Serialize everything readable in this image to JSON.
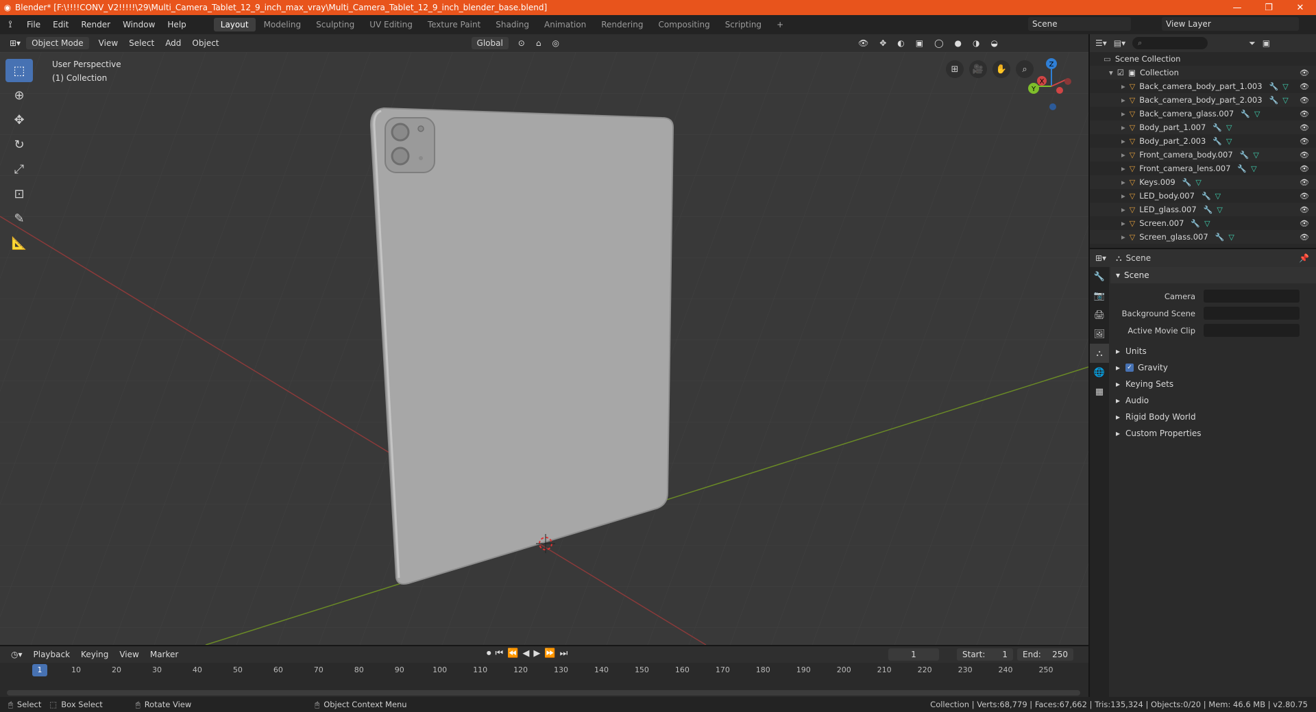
{
  "window": {
    "title": "Blender* [F:\\!!!!CONV_V2!!!!!\\29\\Multi_Camera_Tablet_12_9_inch_max_vray\\Multi_Camera_Tablet_12_9_inch_blender_base.blend]",
    "minimize": "—",
    "maximize": "❐",
    "close": "✕"
  },
  "menu": [
    "File",
    "Edit",
    "Render",
    "Window",
    "Help"
  ],
  "workspaces": [
    "Layout",
    "Modeling",
    "Sculpting",
    "UV Editing",
    "Texture Paint",
    "Shading",
    "Animation",
    "Rendering",
    "Compositing",
    "Scripting",
    "+"
  ],
  "scene_name": "Scene",
  "view_layer": "View Layer",
  "viewport_header": {
    "mode": "Object Mode",
    "menus": [
      "View",
      "Select",
      "Add",
      "Object"
    ],
    "transform": "Global"
  },
  "viewport": {
    "perspective": "User Perspective",
    "collection": "(1) Collection",
    "gizmo": {
      "z": "Z",
      "y": "Y",
      "x": "X"
    }
  },
  "outliner": {
    "search_placeholder": "⌕",
    "root": "Scene Collection",
    "collection": "Collection",
    "objects": [
      "Back_camera_body_part_1.003",
      "Back_camera_body_part_2.003",
      "Back_camera_glass.007",
      "Body_part_1.007",
      "Body_part_2.003",
      "Front_camera_body.007",
      "Front_camera_lens.007",
      "Keys.009",
      "LED_body.007",
      "LED_glass.007",
      "Screen.007",
      "Screen_glass.007"
    ]
  },
  "properties": {
    "header": "Scene",
    "panel": "Scene",
    "fields": [
      {
        "label": "Camera",
        "value": ""
      },
      {
        "label": "Background Scene",
        "value": ""
      },
      {
        "label": "Active Movie Clip",
        "value": ""
      }
    ],
    "subpanels": [
      "Units",
      "Gravity",
      "Keying Sets",
      "Audio",
      "Rigid Body World",
      "Custom Properties"
    ]
  },
  "timeline": {
    "menus": [
      "Playback",
      "Keying",
      "View",
      "Marker"
    ],
    "current_frame": "1",
    "start_label": "Start:",
    "start": "1",
    "end_label": "End:",
    "end": "250",
    "ticks": [
      "1",
      "10",
      "20",
      "30",
      "40",
      "50",
      "60",
      "70",
      "80",
      "90",
      "100",
      "110",
      "120",
      "130",
      "140",
      "150",
      "160",
      "170",
      "180",
      "190",
      "200",
      "210",
      "220",
      "230",
      "240",
      "250"
    ]
  },
  "status": {
    "select": "Select",
    "box_select": "Box Select",
    "rotate": "Rotate View",
    "context": "Object Context Menu",
    "stats": "Collection | Verts:68,779 | Faces:67,662 | Tris:135,324 | Objects:0/20 | Mem: 46.6 MB | v2.80.75"
  }
}
